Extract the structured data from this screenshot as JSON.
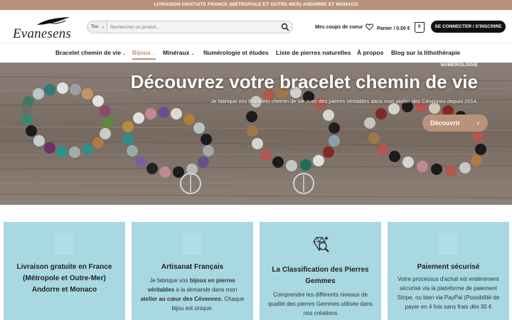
{
  "topbar": {
    "text": "LIVRAISON GRATUITE FRANCE (MÉTROPOLE ET OUTRE-MER) ANDORRE ET MONACO"
  },
  "header": {
    "logo_text": "Evanesens",
    "search": {
      "category": "Tou",
      "placeholder": "Rechercher un produit..."
    },
    "wishlist_label": "Mes coups de coeur",
    "cart_label": "Panier / 0.00 €",
    "cart_count": "0",
    "login_label": "SE CONNECTER / S'INSCRIRE"
  },
  "nav": {
    "items": [
      {
        "label": "Bracelet chemin de vie",
        "has_dropdown": true
      },
      {
        "label": "Bijoux",
        "has_dropdown": true,
        "active": true
      },
      {
        "label": "Minéraux",
        "has_dropdown": true
      },
      {
        "label": "Numérologie et études",
        "has_dropdown": false
      },
      {
        "label": "Liste de pierres naturelles",
        "has_dropdown": false
      },
      {
        "label": "À propos",
        "has_dropdown": false
      },
      {
        "label": "Blog sur la lithothérapie",
        "has_dropdown": false
      }
    ]
  },
  "hero": {
    "tag": "NUMÉROLOGIE",
    "title": "Découvrez votre bracelet chemin de vie",
    "subtitle": "Je fabrique vos bracelets chemin de vie avec des pierres véritables dans mon atelier des Cévennes depuis 2014.",
    "button_label": "Découvrir"
  },
  "features": [
    {
      "title": "Livraison gratuite en France (Métropole et Outre-Mer) Andorre et Monaco",
      "text": ""
    },
    {
      "title": "Artisanat Français",
      "text_parts": [
        "Je fabrique vos ",
        "bijoux en pierres véritables",
        " à la demande dans mon ",
        "atelier au cœur des Cévennes.",
        " Chaque bijou est unique."
      ]
    },
    {
      "title": "La Classification des Pierres Gemmes",
      "text": "Comprendre les différents niveaux de qualité des pierres Gemmes utilisée dans nos créations"
    },
    {
      "title": "Paiement sécurisé",
      "text": "Votre processus d'achat est entièrement sécurisé via la plateforme de paiement Stripe, ou bien via PayPal (Possibilité de payer en 4 fois sans frais dès 30 €"
    }
  ],
  "colors": {
    "accent": "#b8937a",
    "card_bg": "#a8d8e2",
    "dark": "#111111"
  }
}
